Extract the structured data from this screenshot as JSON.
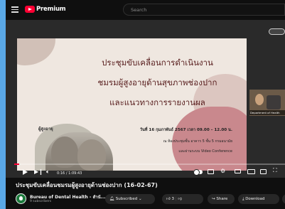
{
  "header": {
    "logo_text": "Premium",
    "search_placeholder": "Search"
  },
  "slide": {
    "title_lines": [
      "ประชุมขับเคลื่อนการดำเนินงาน",
      "ชมรมผู้สูงอายุด้านสุขภาพช่องปาก",
      "และแนวทางการรายงานผล"
    ],
    "date_line": "วันที่ 16 กุมภาพันธ์ 2567 เวลา 09.00 – 12.00 น.",
    "room_line": "ณ ห้องประชุมชั้น อาคาร 5 ชั้น 5 กรมอนามัย",
    "mode_line": "และผ่านระบบ Video Conference",
    "photo_label": "ผู้สูงอายุ",
    "camera_label": "Department of Health"
  },
  "player": {
    "progress": 0.0178,
    "time": "0:16 / 1:09:43"
  },
  "video": {
    "title": "ประชุมขับเคลื่อนชมรมผู้สูงอายุด้านช่องปาก (16-02-67)"
  },
  "channel": {
    "name": "Bureau of Dental Health - สำนั...",
    "subscribers": "9 subscribers"
  },
  "actions": {
    "subscribed_label": "Subscribed",
    "like_count": "3",
    "share_label": "Share",
    "download_label": "Download"
  },
  "colors": {
    "accent": "#ff0033",
    "background": "#0f0f0f"
  }
}
